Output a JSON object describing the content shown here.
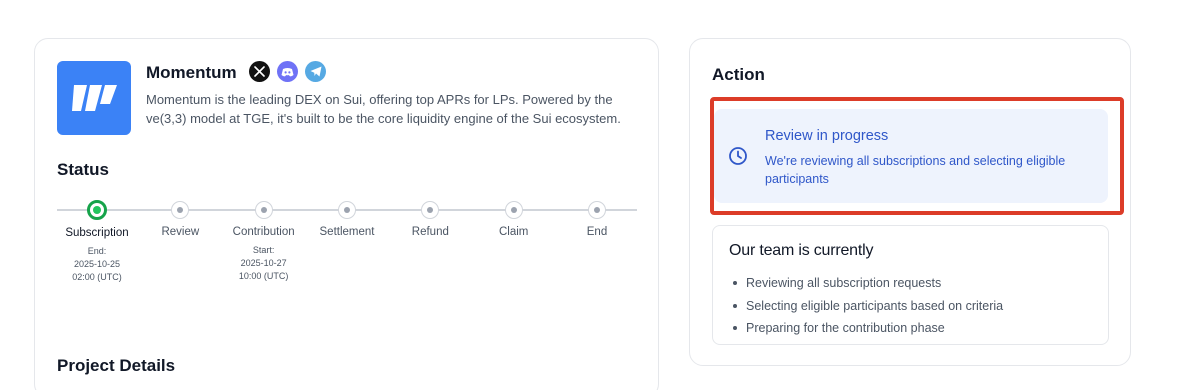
{
  "project": {
    "name": "Momentum",
    "description": "Momentum is the leading DEX on Sui, offering top APRs for LPs. Powered by the ve(3,3) model at TGE, it's built to be the core liquidity engine of the Sui ecosystem.",
    "socials": [
      "x-icon",
      "discord-icon",
      "telegram-icon"
    ]
  },
  "status": {
    "title": "Status",
    "steps": [
      {
        "label": "Subscription",
        "active": true,
        "sub": [
          "End:",
          "2025-10-25",
          "02:00 (UTC)"
        ]
      },
      {
        "label": "Review",
        "active": false,
        "sub": []
      },
      {
        "label": "Contribution",
        "active": false,
        "sub": [
          "Start:",
          "2025-10-27",
          "10:00 (UTC)"
        ]
      },
      {
        "label": "Settlement",
        "active": false,
        "sub": []
      },
      {
        "label": "Refund",
        "active": false,
        "sub": []
      },
      {
        "label": "Claim",
        "active": false,
        "sub": []
      },
      {
        "label": "End",
        "active": false,
        "sub": []
      }
    ]
  },
  "details": {
    "title": "Project Details"
  },
  "action": {
    "title": "Action",
    "review": {
      "title": "Review in progress",
      "text": "We're reviewing all subscriptions and selecting eligible participants"
    },
    "team": {
      "title": "Our team is currently",
      "items": [
        "Reviewing all subscription requests",
        "Selecting eligible participants based on criteria",
        "Preparing for the contribution phase"
      ]
    }
  },
  "colors": {
    "accent_blue": "#3b82f6",
    "review_text": "#2f57c9",
    "review_bg": "#eef3fd",
    "active_green": "#16a34a",
    "highlight_red": "#dc3c28"
  }
}
